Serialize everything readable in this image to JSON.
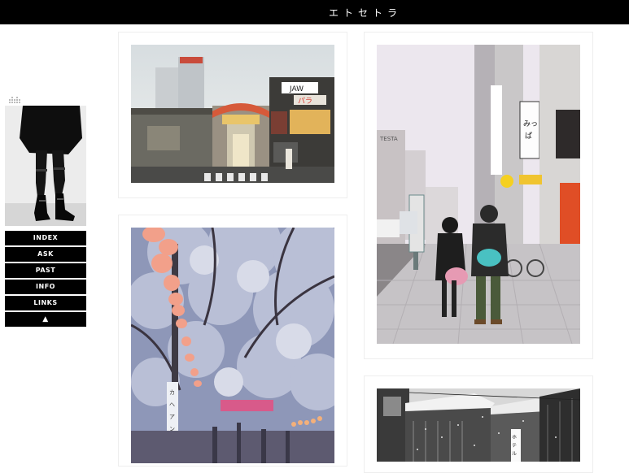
{
  "header": {
    "title": "エトセトラ"
  },
  "sidebar": {
    "avatar_icon": "photo-legs-boots",
    "nav": [
      {
        "label": "INDEX"
      },
      {
        "label": "ASK"
      },
      {
        "label": "PAST"
      },
      {
        "label": "INFO"
      },
      {
        "label": "LINKS"
      },
      {
        "label": "▲"
      }
    ]
  },
  "posts": [
    {
      "photo": "shopping-arcade-street",
      "signs": [
        "JAW",
        "パラ"
      ]
    },
    {
      "photo": "couple-walking-street",
      "signs": [
        "みっぱ",
        "TESTA"
      ]
    },
    {
      "photo": "cherry-blossom-lanterns",
      "signs": [
        "カヘアント協会"
      ]
    },
    {
      "photo": "snowy-houses-bw",
      "signs": [
        "ホテル"
      ]
    }
  ],
  "colors": {
    "topbar": "#000000",
    "nav_bg": "#000000",
    "nav_text": "#ffffff",
    "post_border": "#eeeeee"
  }
}
